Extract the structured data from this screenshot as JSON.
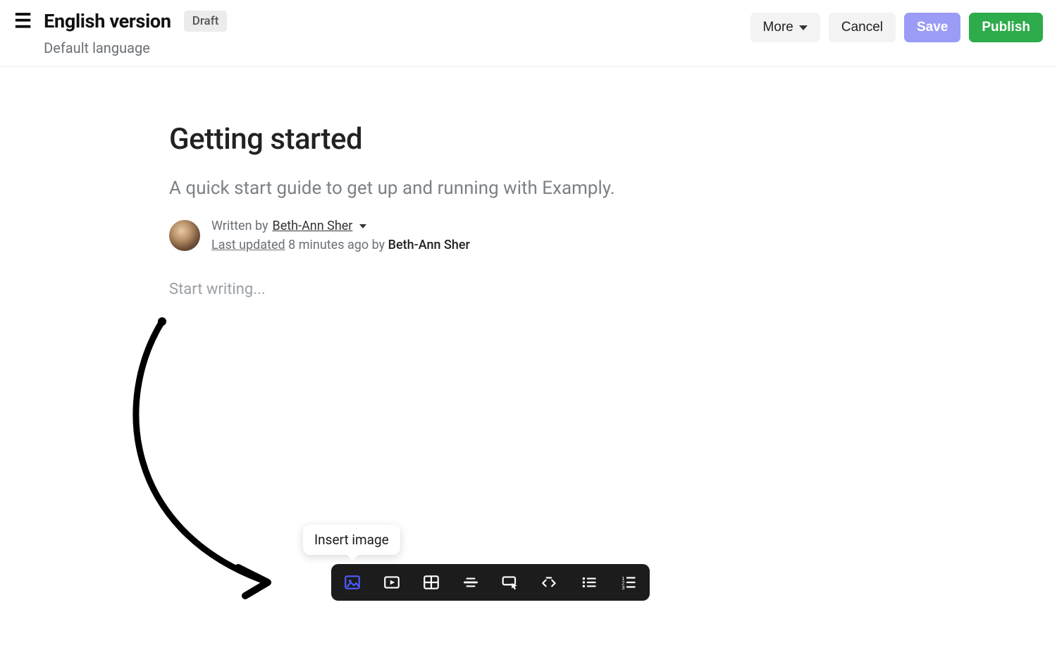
{
  "header": {
    "title": "English version",
    "badge": "Draft",
    "subtitle": "Default language",
    "actions": {
      "more": "More",
      "cancel": "Cancel",
      "save": "Save",
      "publish": "Publish"
    }
  },
  "doc": {
    "title": "Getting started",
    "subtitle": "A quick start guide to get up and running with Examply.",
    "author": {
      "written_by_label": "Written by",
      "author_name": "Beth-Ann Sher",
      "last_updated_label": "Last updated",
      "updated_time": "8 minutes ago",
      "by_label": "by",
      "editor_name": "Beth-Ann Sher"
    },
    "placeholder": "Start writing..."
  },
  "toolbar": {
    "tooltip": "Insert image",
    "tools": [
      {
        "name": "insert-image",
        "active": true
      },
      {
        "name": "insert-video",
        "active": false
      },
      {
        "name": "insert-table",
        "active": false
      },
      {
        "name": "insert-divider",
        "active": false
      },
      {
        "name": "insert-button",
        "active": false
      },
      {
        "name": "insert-code",
        "active": false
      },
      {
        "name": "bulleted-list",
        "active": false
      },
      {
        "name": "numbered-list",
        "active": false
      }
    ]
  }
}
